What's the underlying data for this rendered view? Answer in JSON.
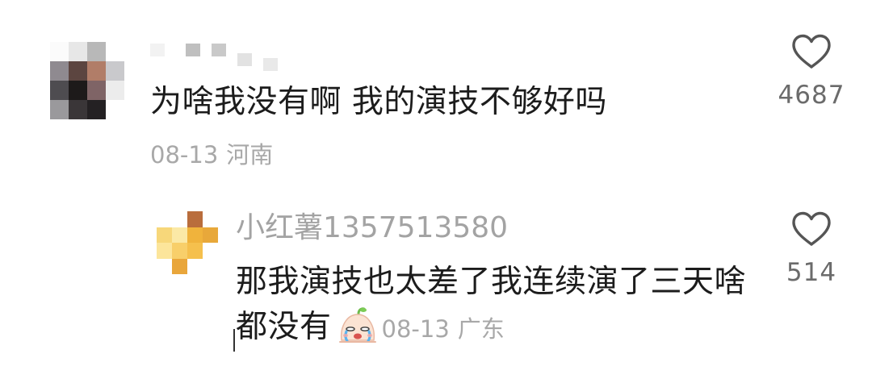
{
  "comment": {
    "text": "为啥我没有啊 我的演技不够好吗",
    "date": "08-13",
    "location": "河南",
    "likes": "4687",
    "avatar": "pixelated-avatar",
    "username_obscured": true
  },
  "reply": {
    "username": "小红薯1357513580",
    "text": "那我演技也太差了我连续演了三天啥都没有",
    "emoji": "crying-face-emoji",
    "date": "08-13",
    "location": "广东",
    "likes": "514",
    "avatar": "pixelated-avatar"
  },
  "colors": {
    "text": "#1c1c1c",
    "meta": "#a8a8a8",
    "like_count": "#6b6b6b",
    "heart_outline": "#555555"
  },
  "icons": {
    "like": "heart-icon"
  }
}
